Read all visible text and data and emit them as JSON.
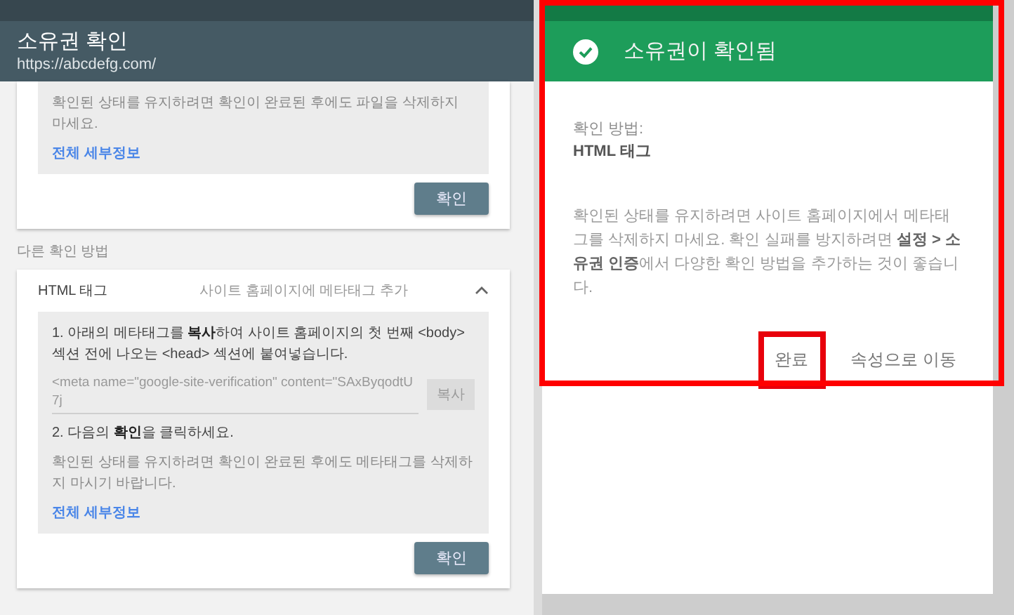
{
  "header": {
    "title": "소유권 확인",
    "url": "https://abcdefg.com/"
  },
  "file_card": {
    "notice": "확인된 상태를 유지하려면 확인이 완료된 후에도 파일을 삭제하지 마세요.",
    "link": "전체 세부정보",
    "button": "확인"
  },
  "section_label": "다른 확인 방법",
  "method_card": {
    "name": "HTML 태그",
    "description": "사이트 홈페이지에 메타태그 추가",
    "expanded": true,
    "step_1": "1. 아래의 메타태그를 **복사**하여 사이트 홈페이지의 첫 번째 <body> 섹션 전에 나오는 <head> 섹션에 붙여넣습니다.",
    "meta_tag": "<meta name=\"google-site-verification\" content=\"SAxByqodtU7j",
    "copy_button": "복사",
    "step_2": "2. 다음의 **확인**을 클릭하세요.",
    "notice": "확인된 상태를 유지하려면 확인이 완료된 후에도 메타태그를 삭제하지 마시기 바랍니다.",
    "link": "전체 세부정보",
    "button": "확인"
  },
  "dialog": {
    "title": "소유권이 확인됨",
    "highlighted": true,
    "method_label": "확인 방법:",
    "method_value": "HTML 태그",
    "message": "확인된 상태를 유지하려면 사이트 홈페이지에서 메타태그를 삭제하지 마세요. 확인 실패를 방지하려면 **설정 > 소유권 인증**에서 다양한 확인 방법을 추가하는 것이 좋습니다.",
    "buttons": [
      {
        "label": "완료",
        "highlighted": true
      },
      {
        "label": "속성으로 이동",
        "highlighted": false
      }
    ]
  }
}
